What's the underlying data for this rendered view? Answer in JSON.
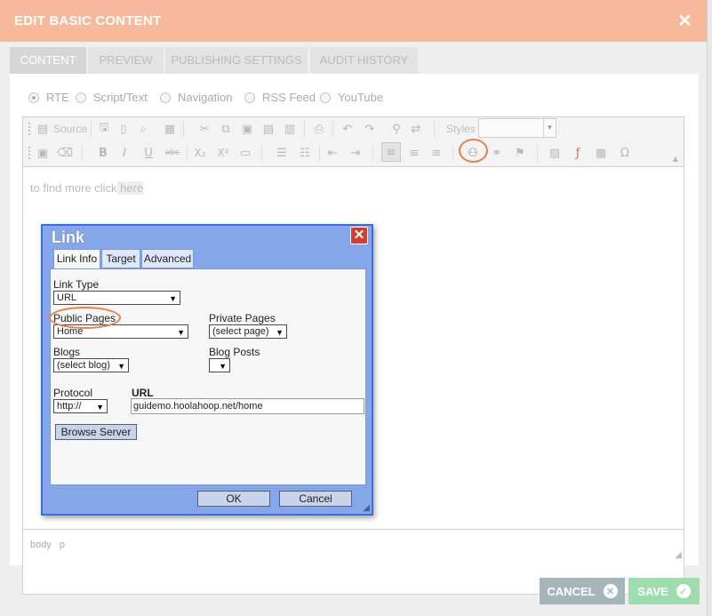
{
  "modal": {
    "title": "EDIT BASIC CONTENT",
    "close_symbol": "✕"
  },
  "tabs": [
    {
      "label": "CONTENT",
      "active": true
    },
    {
      "label": "PREVIEW",
      "active": false
    },
    {
      "label": "PUBLISHING SETTINGS",
      "active": false
    },
    {
      "label": "AUDIT HISTORY",
      "active": false
    }
  ],
  "content_types": [
    {
      "label": "RTE",
      "selected": true
    },
    {
      "label": "Script/Text",
      "selected": false
    },
    {
      "label": "Navigation",
      "selected": false
    },
    {
      "label": "RSS Feed",
      "selected": false
    },
    {
      "label": "YouTube",
      "selected": false
    }
  ],
  "toolbar": {
    "source_label": "Source",
    "styles_label": "Styles",
    "styles_value": "",
    "bold": "B",
    "italic": "I",
    "underline": "U",
    "strike": "abc",
    "subscript": "X₂",
    "superscript": "X²",
    "link_highlighted": true
  },
  "editor": {
    "text_before": "to find more click",
    "link_text": " here",
    "status_path": "body p"
  },
  "link_dialog": {
    "title": "Link",
    "close_symbol": "✕",
    "tabs": [
      "Link Info",
      "Target",
      "Advanced"
    ],
    "active_tab": "Link Info",
    "link_type_label": "Link Type",
    "link_type_value": "URL",
    "public_pages_label": "Public Pages",
    "public_pages_value": "Home",
    "private_pages_label": "Private Pages",
    "private_pages_value": "(select page)",
    "blogs_label": "Blogs",
    "blogs_value": "(select blog)",
    "blog_posts_label": "Blog Posts",
    "blog_posts_value": "",
    "protocol_label": "Protocol",
    "protocol_value": "http://",
    "url_label": "URL",
    "url_value": "guidemo.hoolahoop.net/home",
    "browse_label": "Browse Server",
    "ok_label": "OK",
    "cancel_label": "Cancel"
  },
  "footer": {
    "cancel_label": "CANCEL",
    "save_label": "SAVE"
  },
  "colors": {
    "header": "#f6b99b",
    "cancel_button": "#a6b4bc",
    "save_button": "#9fdcae",
    "highlight": "#e87f45",
    "dialog_frame": "#3c6fd4"
  }
}
